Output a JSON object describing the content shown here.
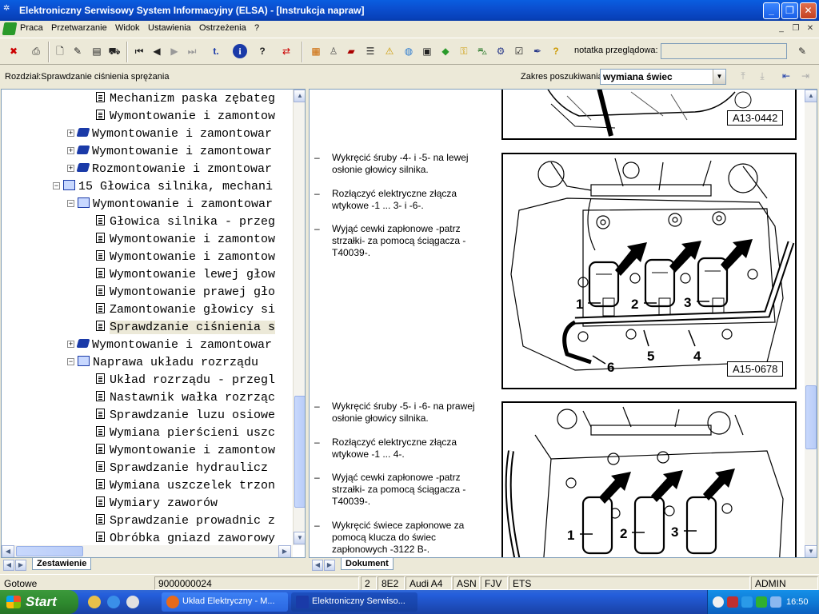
{
  "window": {
    "title": "Elektroniczny Serwisowy System Informacyjny (ELSA) - [Instrukcja napraw]",
    "minimize": "_",
    "maximize": "❐",
    "close": "✕"
  },
  "menu": {
    "items": [
      "Praca",
      "Przetwarzanie",
      "Widok",
      "Ustawienia",
      "Ostrzeżenia",
      "?"
    ],
    "mdi_min": "_",
    "mdi_restore": "❐",
    "mdi_close": "✕"
  },
  "toolbar": {
    "note_label": "notatka przeglądowa:",
    "note_value": ""
  },
  "search_row": {
    "section": "Rozdział:Sprawdzanie ciśnienia sprężania",
    "search_label": "Zakres poszukiwania",
    "search_value": "wymiana świec"
  },
  "tree": {
    "items": [
      {
        "text": "Mechanizm paska zębateg",
        "icon": "doc",
        "expander": ""
      },
      {
        "text": "Wymontowanie i zamontow",
        "icon": "doc",
        "expander": ""
      },
      {
        "text": "Wymontowanie i zamontowar",
        "icon": "book",
        "expander": "+"
      },
      {
        "text": "Wymontowanie i zamontowar",
        "icon": "book",
        "expander": "+"
      },
      {
        "text": "Rozmontowanie i zmontowar",
        "icon": "book",
        "expander": "+"
      },
      {
        "text": "15 Głowica silnika, mechani",
        "icon": "openbook",
        "expander": "−"
      },
      {
        "text": "Wymontowanie i zamontowar",
        "icon": "openbook",
        "expander": "−"
      },
      {
        "text": "Głowica silnika - przeg",
        "icon": "doc",
        "expander": ""
      },
      {
        "text": "Wymontowanie i zamontow",
        "icon": "doc",
        "expander": ""
      },
      {
        "text": "Wymontowanie i zamontow",
        "icon": "doc",
        "expander": ""
      },
      {
        "text": "Wymontowanie lewej głow",
        "icon": "doc",
        "expander": ""
      },
      {
        "text": "Wymontowanie prawej gło",
        "icon": "doc",
        "expander": ""
      },
      {
        "text": "Zamontowanie głowicy si",
        "icon": "doc",
        "expander": ""
      },
      {
        "text": "Sprawdzanie ciśnienia s",
        "icon": "doc",
        "expander": "",
        "selected": true
      },
      {
        "text": "Wymontowanie i zamontowar",
        "icon": "book",
        "expander": "+"
      },
      {
        "text": "Naprawa układu rozrządu",
        "icon": "openbook",
        "expander": "−"
      },
      {
        "text": "Układ rozrządu - przegl",
        "icon": "doc",
        "expander": ""
      },
      {
        "text": "Nastawnik wałka rozrząc",
        "icon": "doc",
        "expander": ""
      },
      {
        "text": "Sprawdzanie luzu osiowe",
        "icon": "doc",
        "expander": ""
      },
      {
        "text": "Wymiana pierścieni uszc",
        "icon": "doc",
        "expander": ""
      },
      {
        "text": "Wymontowanie i zamontow",
        "icon": "doc",
        "expander": ""
      },
      {
        "text": "Sprawdzanie hydraulicz",
        "icon": "doc",
        "expander": ""
      },
      {
        "text": "Wymiana uszczelek trzon",
        "icon": "doc",
        "expander": ""
      },
      {
        "text": "Wymiary zaworów",
        "icon": "doc",
        "expander": ""
      },
      {
        "text": "Sprawdzanie prowadnic z",
        "icon": "doc",
        "expander": ""
      },
      {
        "text": "Obróbka gniazd zaworowy",
        "icon": "doc",
        "expander": ""
      }
    ]
  },
  "document": {
    "fig_top_label": "A13-0442",
    "block1": [
      "Wykręcić śruby -4- i -5- na lewej osłonie głowicy silnika.",
      "Rozłączyć elektryczne złącza wtykowe -1 ... 3- i -6-.",
      "Wyjąć cewki zapłonowe -patrz strzałki- za pomocą ściągacza -T40039-."
    ],
    "fig1_label": "A15-0678",
    "fig1_callouts": [
      "1",
      "2",
      "3",
      "4",
      "5",
      "6"
    ],
    "block2": [
      "Wykręcić śruby -5- i -6- na prawej osłonie głowicy silnika.",
      "Rozłączyć elektryczne złącza wtykowe -1 ... 4-.",
      "Wyjąć cewki zapłonowe -patrz strzałki- za pomocą ściągacza -T40039-.",
      "Wykręcić świece zapłonowe za pomocą klucza do świec zapłonowych -3122 B-."
    ],
    "fig2_callouts": [
      "1",
      "2",
      "3"
    ],
    "dash": "–"
  },
  "tabs": {
    "left": "Zestawienie",
    "right": "Dokument"
  },
  "status": {
    "state": "Gotowe",
    "vin": "9000000024",
    "f1": "2",
    "f2": "8E2",
    "f3": "Audi A4",
    "f4": "ASN",
    "f5": "FJV",
    "f6": "ETS",
    "user": "ADMIN"
  },
  "taskbar": {
    "start": "Start",
    "tasks": [
      "Układ Elektryczny - M...",
      "Elektroniczny Serwiso..."
    ],
    "clock": "16:50"
  }
}
